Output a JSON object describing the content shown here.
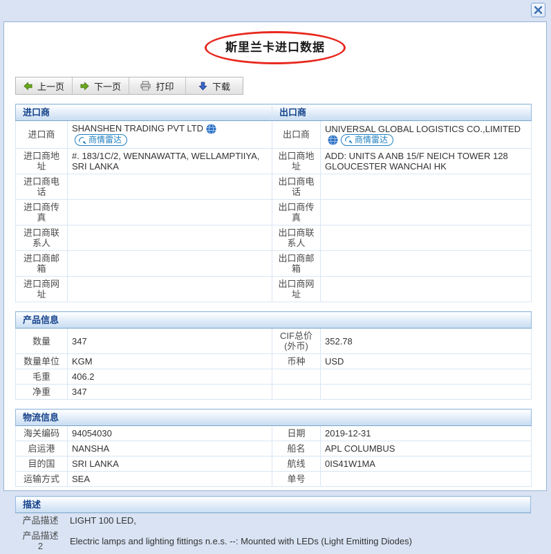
{
  "window": {
    "page_background": "#d9e3f3",
    "title": "斯里兰卡进口数据",
    "title_circle_color": "#e8281e"
  },
  "toolbar": {
    "prev_label": "上一页",
    "next_label": "下一页",
    "print_label": "打印",
    "download_label": "下载"
  },
  "parties": {
    "importer_header": "进口商",
    "exporter_header": "出口商",
    "radar_badge": "商情雷达",
    "rows": {
      "name": {
        "l": "进口商",
        "lv": "SHANSHEN TRADING PVT LTD",
        "r": "出口商",
        "rv": "UNIVERSAL GLOBAL LOGISTICS CO.,LIMITED"
      },
      "address": {
        "l": "进口商地址",
        "lv": "#. 183/1C/2, WENNAWATTA, WELLAMPTIIYA, SRI LANKA",
        "r": "出口商地址",
        "rv": "ADD: UNITS A ANB 15/F NEICH TOWER 128 GLOUCESTER WANCHAI HK"
      },
      "phone": {
        "l": "进口商电话",
        "lv": "",
        "r": "出口商电话",
        "rv": ""
      },
      "fax": {
        "l": "进口商传真",
        "lv": "",
        "r": "出口商传真",
        "rv": ""
      },
      "contact": {
        "l": "进口商联系人",
        "lv": "",
        "r": "出口商联系人",
        "rv": ""
      },
      "email": {
        "l": "进口商邮箱",
        "lv": "",
        "r": "出口商邮箱",
        "rv": ""
      },
      "website": {
        "l": "进口商网址",
        "lv": "",
        "r": "出口商网址",
        "rv": ""
      }
    }
  },
  "product": {
    "header": "产品信息",
    "rows": [
      {
        "ll": "数量",
        "lv": "347",
        "rl": "CIF总价(外币)",
        "rv": "352.78"
      },
      {
        "ll": "数量单位",
        "lv": "KGM",
        "rl": "币种",
        "rv": "USD"
      },
      {
        "ll": "毛重",
        "lv": "406.2",
        "rl": "",
        "rv": ""
      },
      {
        "ll": "净重",
        "lv": "347",
        "rl": "",
        "rv": ""
      }
    ]
  },
  "logistics": {
    "header": "物流信息",
    "rows": [
      {
        "ll": "海关编码",
        "lv": "94054030",
        "rl": "日期",
        "rv": "2019-12-31"
      },
      {
        "ll": "启运港",
        "lv": "NANSHA",
        "rl": "船名",
        "rv": "APL COLUMBUS"
      },
      {
        "ll": "目的国",
        "lv": "SRI LANKA",
        "rl": "航线",
        "rv": "0IS41W1MA"
      },
      {
        "ll": "运输方式",
        "lv": "SEA",
        "rl": "单号",
        "rv": ""
      }
    ]
  },
  "description": {
    "header": "描述",
    "rows": [
      {
        "label": "产品描述",
        "value": "LIGHT 100 LED,"
      },
      {
        "label": "产品描述 2",
        "value": "Electric lamps and lighting fittings n.e.s. --: Mounted with LEDs (Light Emitting Diodes)"
      }
    ]
  },
  "colors": {
    "section_header_text": "#15428b",
    "table_border": "#94b9de",
    "radar_badge_blue": "#1e7fc0",
    "arrow_green": "#6aa821",
    "arrow_blue": "#3a66c8"
  }
}
